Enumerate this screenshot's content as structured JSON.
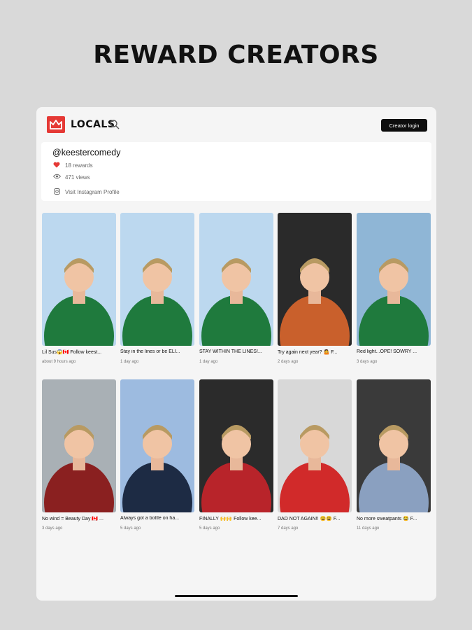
{
  "headline": "REWARD CREATORS",
  "app": {
    "brand": "LOCALS",
    "brand_color": "#e53935",
    "creator_login": "Creator login"
  },
  "profile": {
    "handle": "@keestercomedy",
    "rewards": "18 rewards",
    "views": "471 views",
    "instagram": "Visit Instagram Profile"
  },
  "videos": [
    {
      "title": "Lil Sus😱🇨🇦 Follow keest...",
      "time": "about 9 hours ago",
      "bg": "#bcd8ef",
      "fg": "#1f7a3d"
    },
    {
      "title": "Stay in the lines or be ELI...",
      "time": "1 day ago",
      "bg": "#bcd8ef",
      "fg": "#1f7a3d"
    },
    {
      "title": "STAY WITHIN THE LINES!...",
      "time": "1 day ago",
      "bg": "#bcd8ef",
      "fg": "#1f7a3d"
    },
    {
      "title": "Try again next year? 🤷 F...",
      "time": "2 days ago",
      "bg": "#2a2a2a",
      "fg": "#c9602c"
    },
    {
      "title": "Red light...OPE! SOWRY ...",
      "time": "3 days ago",
      "bg": "#8fb6d6",
      "fg": "#1f7a3d"
    },
    {
      "title": "No wind = Beauty Day 🇨🇦 ...",
      "time": "3 days ago",
      "bg": "#a9b0b5",
      "fg": "#8a2020"
    },
    {
      "title": "Always got a bottle on ha...",
      "time": "5 days ago",
      "bg": "#9dbbe0",
      "fg": "#1d2b44"
    },
    {
      "title": "FINALLY 🙌🙌 Follow kee...",
      "time": "5 days ago",
      "bg": "#2b2b2b",
      "fg": "#b8242a"
    },
    {
      "title": "DAD NOT AGAIN!! 😫😫 F...",
      "time": "7 days ago",
      "bg": "#d8d8d8",
      "fg": "#d12a2a"
    },
    {
      "title": "No more sweatpants 😂 F...",
      "time": "11 days ago",
      "bg": "#3a3a3a",
      "fg": "#8aa0c0"
    }
  ]
}
